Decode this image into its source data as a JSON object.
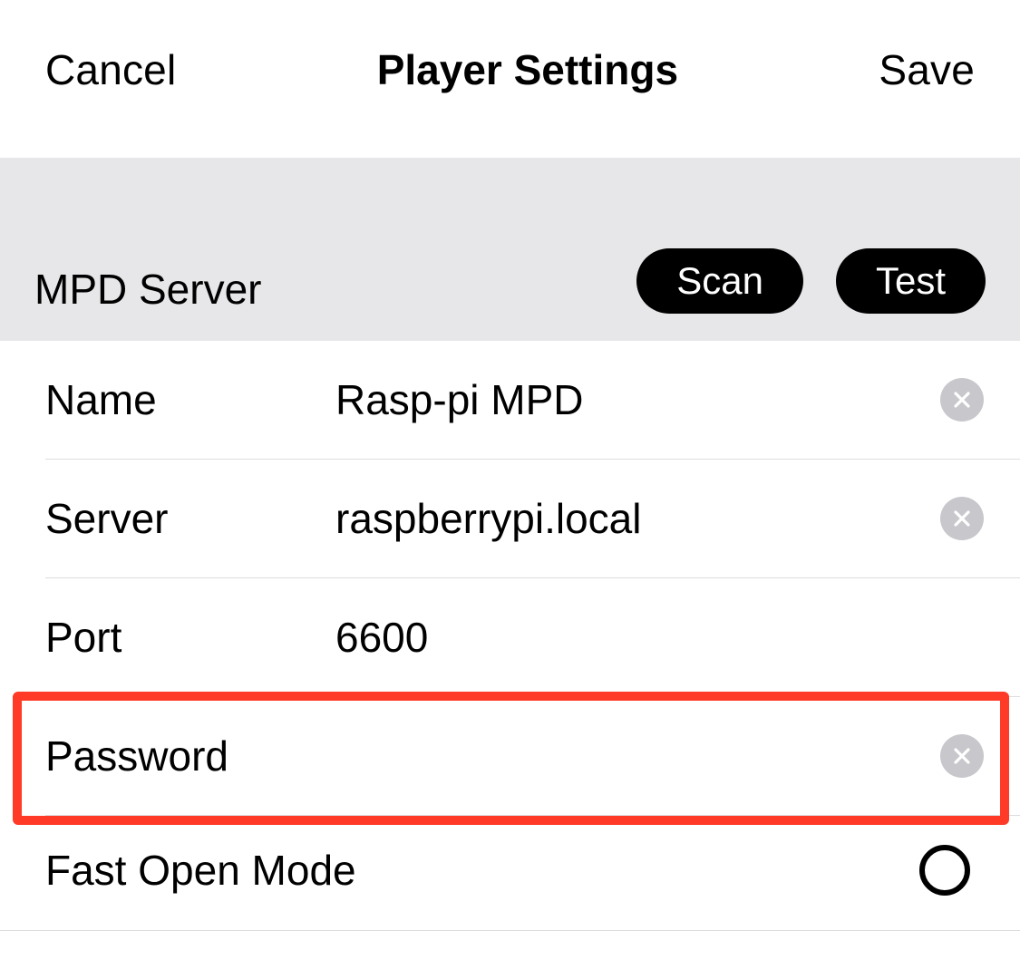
{
  "nav": {
    "cancel": "Cancel",
    "title": "Player Settings",
    "save": "Save"
  },
  "section": {
    "title": "MPD Server",
    "scan": "Scan",
    "test": "Test"
  },
  "fields": {
    "name": {
      "label": "Name",
      "value": "Rasp-pi MPD"
    },
    "server": {
      "label": "Server",
      "value": "raspberrypi.local"
    },
    "port": {
      "label": "Port",
      "value": "6600"
    },
    "password": {
      "label": "Password",
      "value": ""
    },
    "fastopen": {
      "label": "Fast Open Mode"
    }
  }
}
